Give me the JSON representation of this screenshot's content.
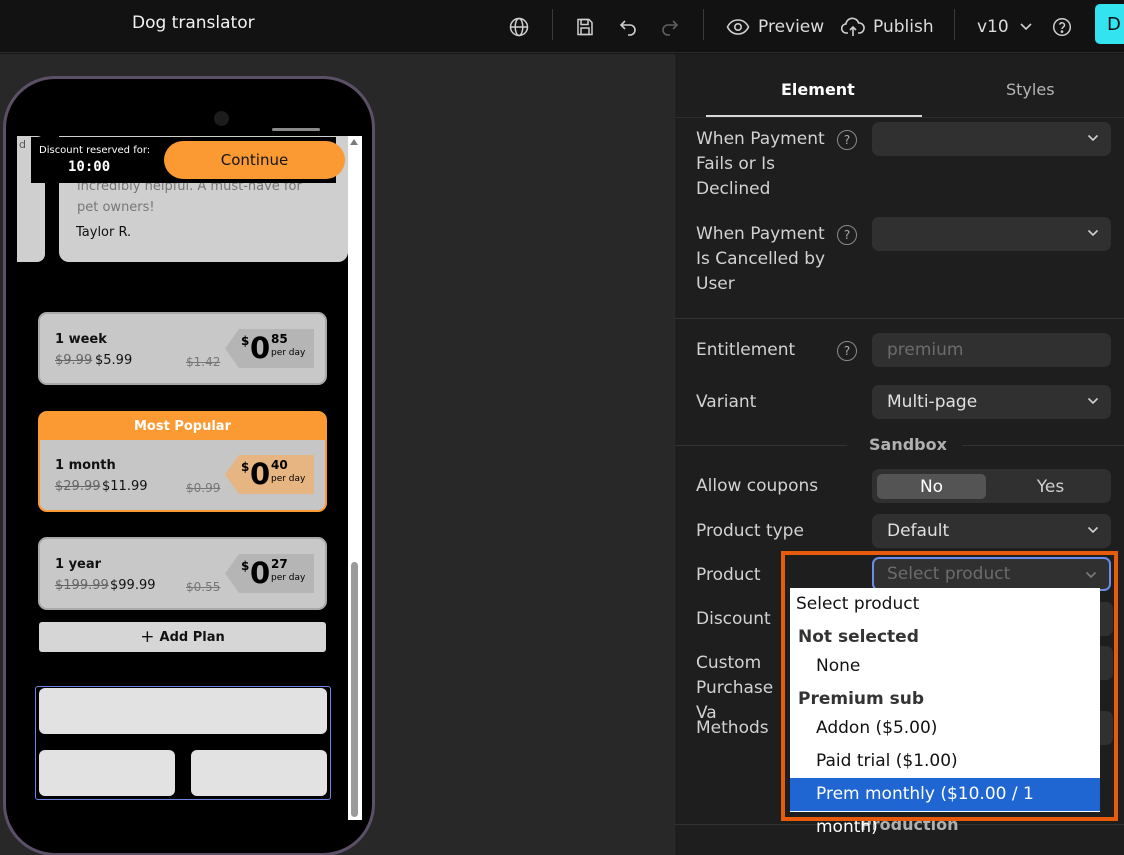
{
  "app": {
    "title": "Dog translator",
    "avatar_letter": "D",
    "accent": "#34e3f0"
  },
  "toolbar": {
    "preview_label": "Preview",
    "publish_label": "Publish",
    "version_label": "v10"
  },
  "preview": {
    "review_left_snippet": "d",
    "review_text": "incredibly helpful. A must-have for pet owners!",
    "review_author": "Taylor R.",
    "discount_label": "Discount reserved for:",
    "discount_timer": "10:00",
    "continue_label": "Continue",
    "popular_label": "Most Popular",
    "add_plan_label": "Add Plan",
    "plans": [
      {
        "name": "1 week",
        "old_price": "$9.99",
        "new_price": "$5.99",
        "old_per_day": "$1.42",
        "currency": "$",
        "per_day_int": "0",
        "per_day_cents": "85",
        "per_day_label": "per day"
      },
      {
        "name": "1 month",
        "old_price": "$29.99",
        "new_price": "$11.99",
        "old_per_day": "$0.99",
        "currency": "$",
        "per_day_int": "0",
        "per_day_cents": "40",
        "per_day_label": "per day"
      },
      {
        "name": "1 year",
        "old_price": "$199.99",
        "new_price": "$99.99",
        "old_per_day": "$0.55",
        "currency": "$",
        "per_day_int": "0",
        "per_day_cents": "27",
        "per_day_label": "per day"
      }
    ],
    "brand_color": "#fb9a32"
  },
  "panel": {
    "tabs": [
      "Element",
      "Styles"
    ],
    "fields": {
      "payment_fails_label": "When Payment Fails or Is Declined",
      "payment_cancelled_label": "When Payment Is Cancelled by User",
      "entitlement_label": "Entitlement",
      "entitlement_placeholder": "premium",
      "variant_label": "Variant",
      "variant_value": "Multi-page",
      "allow_coupons_label": "Allow coupons",
      "coupons_no": "No",
      "coupons_yes": "Yes",
      "product_type_label": "Product type",
      "product_type_value": "Default",
      "product_label": "Product",
      "product_placeholder": "Select product",
      "discount_label": "Discount",
      "custom_purchase_label": "Custom Purchase Va",
      "methods_label": "Methods"
    },
    "sandbox_title": "Sandbox",
    "production_title": "Production"
  },
  "dropdown": {
    "title": "Select product",
    "groups": [
      {
        "label": "Not selected",
        "options": [
          "None"
        ]
      },
      {
        "label": "Premium sub",
        "options": [
          "Addon ($5.00)",
          "Paid trial ($1.00)",
          "Prem monthly ($10.00 / 1 month)"
        ]
      }
    ],
    "active_option": "Prem monthly ($10.00 / 1 month)",
    "highlight_color": "#e95b0c"
  }
}
